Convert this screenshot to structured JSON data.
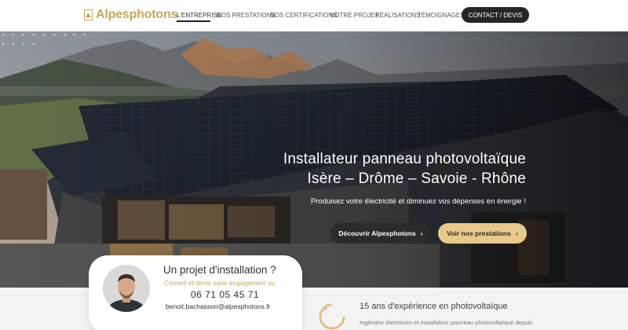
{
  "brand": {
    "name": "Alpesphotons",
    "color": "#c6a75d"
  },
  "nav": {
    "items": [
      {
        "label": "L'ENTREPRISE",
        "active": true
      },
      {
        "label": "NOS PRESTATIONS"
      },
      {
        "label": "NOS CERTIFICATIONS"
      },
      {
        "label": "VOTRE PROJET"
      },
      {
        "label": "RÉALISATIONS"
      },
      {
        "label": "TÉMOIGNAGES"
      }
    ],
    "cta": "CONTACT / DEVIS"
  },
  "hero": {
    "title_line1": "Installateur panneau photovoltaïque",
    "title_line2": "Isère – Drôme – Savoie - Rhône",
    "subtitle": "Produisez votre électricité et diminuez vos dépenses en énergie !",
    "primary_button": "Découvrir Alpesphotons",
    "secondary_button": "Voir nos prestations",
    "button_arrow": "›"
  },
  "contact_card": {
    "title": "Un projet d'installation ?",
    "subtitle": "Conseil et devis sans engagement au",
    "phone": "06 71 05 45 71",
    "email": "benoit.bachasson@alpesphotons.fr"
  },
  "experience": {
    "title": "15 ans d'expérience en photovoltaïque",
    "text": "Ingénieur électricien et installateur panneau photovoltaïque depuis"
  },
  "colors": {
    "gold": "#e9c98a",
    "dark_button": "#2b2b2b",
    "nav_cta": "#262626"
  }
}
